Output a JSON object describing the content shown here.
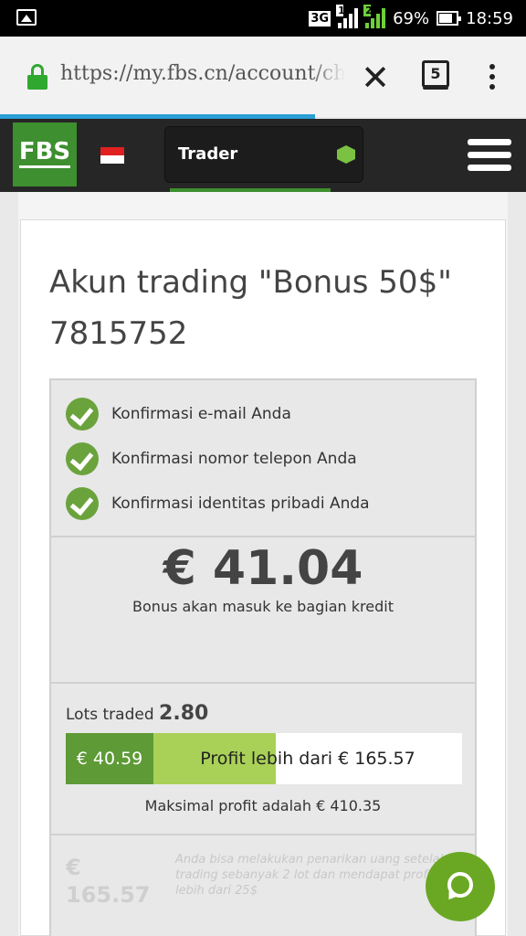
{
  "status_bar": {
    "network": "3G",
    "sim1": "1",
    "sim2": "2",
    "battery": "69%",
    "time": "18:59"
  },
  "browser": {
    "url": "https://my.fbs.cn/account/change",
    "tab_count": "5",
    "close_icon": "close-icon",
    "menu_icon": "more-vert-icon",
    "accent": "#2a9fd6"
  },
  "header": {
    "logo": "FBS",
    "account_type": "Trader",
    "brand_green": "#3d8f2f"
  },
  "account": {
    "title": "Akun trading \"Bonus 50$\"",
    "number": "7815752"
  },
  "checklist": [
    {
      "label": "Konfirmasi e-mail Anda"
    },
    {
      "label": "Konfirmasi nomor telepon Anda"
    },
    {
      "label": "Konfirmasi identitas pribadi Anda"
    }
  ],
  "bonus": {
    "amount": "€ 41.04",
    "note": "Bonus akan masuk ke bagian kredit"
  },
  "lots": {
    "label": "Lots traded",
    "value": "2.80",
    "current_profit": "€ 40.59",
    "target_text": "Profit lebih dari € 165.57",
    "max_profit": "Maksimal profit adalah € 410.35"
  },
  "withdraw": {
    "amount_line1": "€",
    "amount_line2": "165.57",
    "note": "Anda bisa melakukan penarikan uang setelah trading sebanyak 2 lot dan mendapat profit lebih dari 25$"
  }
}
